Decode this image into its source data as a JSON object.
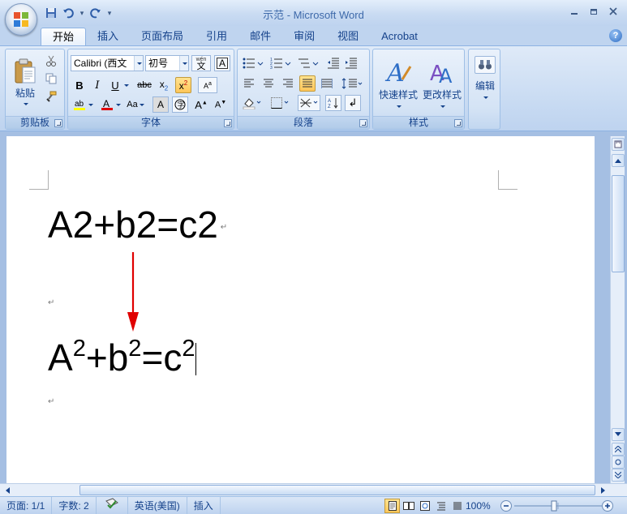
{
  "window": {
    "title": "示范 - Microsoft Word"
  },
  "tabs": [
    {
      "label": "开始",
      "active": true
    },
    {
      "label": "插入"
    },
    {
      "label": "页面布局"
    },
    {
      "label": "引用"
    },
    {
      "label": "邮件"
    },
    {
      "label": "审阅"
    },
    {
      "label": "视图"
    },
    {
      "label": "Acrobat"
    }
  ],
  "ribbon": {
    "clipboard": {
      "label": "剪贴板",
      "paste_label": "粘贴"
    },
    "font": {
      "label": "字体",
      "font_name": "Calibri (西文",
      "font_size": "初号",
      "wen_label": "wén"
    },
    "paragraph": {
      "label": "段落"
    },
    "styles": {
      "label": "样式",
      "quick_styles_label": "快速样式",
      "change_styles_label": "更改样式"
    },
    "editing": {
      "label": "编辑"
    }
  },
  "document": {
    "line1": {
      "a": "A2",
      "plus1": "+",
      "b": "b2",
      "eq": "=",
      "c": "c2"
    },
    "line2": {
      "base_a": "A",
      "exp_a": "2",
      "plus": "+",
      "base_b": "b",
      "exp_b": "2",
      "eq": "=",
      "base_c": "c",
      "exp_c": "2"
    },
    "paragraph_mark": "↵"
  },
  "status": {
    "page": "页面: 1/1",
    "words": "字数: 2",
    "language": "英语(美国)",
    "mode": "插入",
    "zoom": "100%"
  },
  "colors": {
    "accent": "#15428b",
    "arrow": "#e00000",
    "highlight": "#ffc659"
  }
}
